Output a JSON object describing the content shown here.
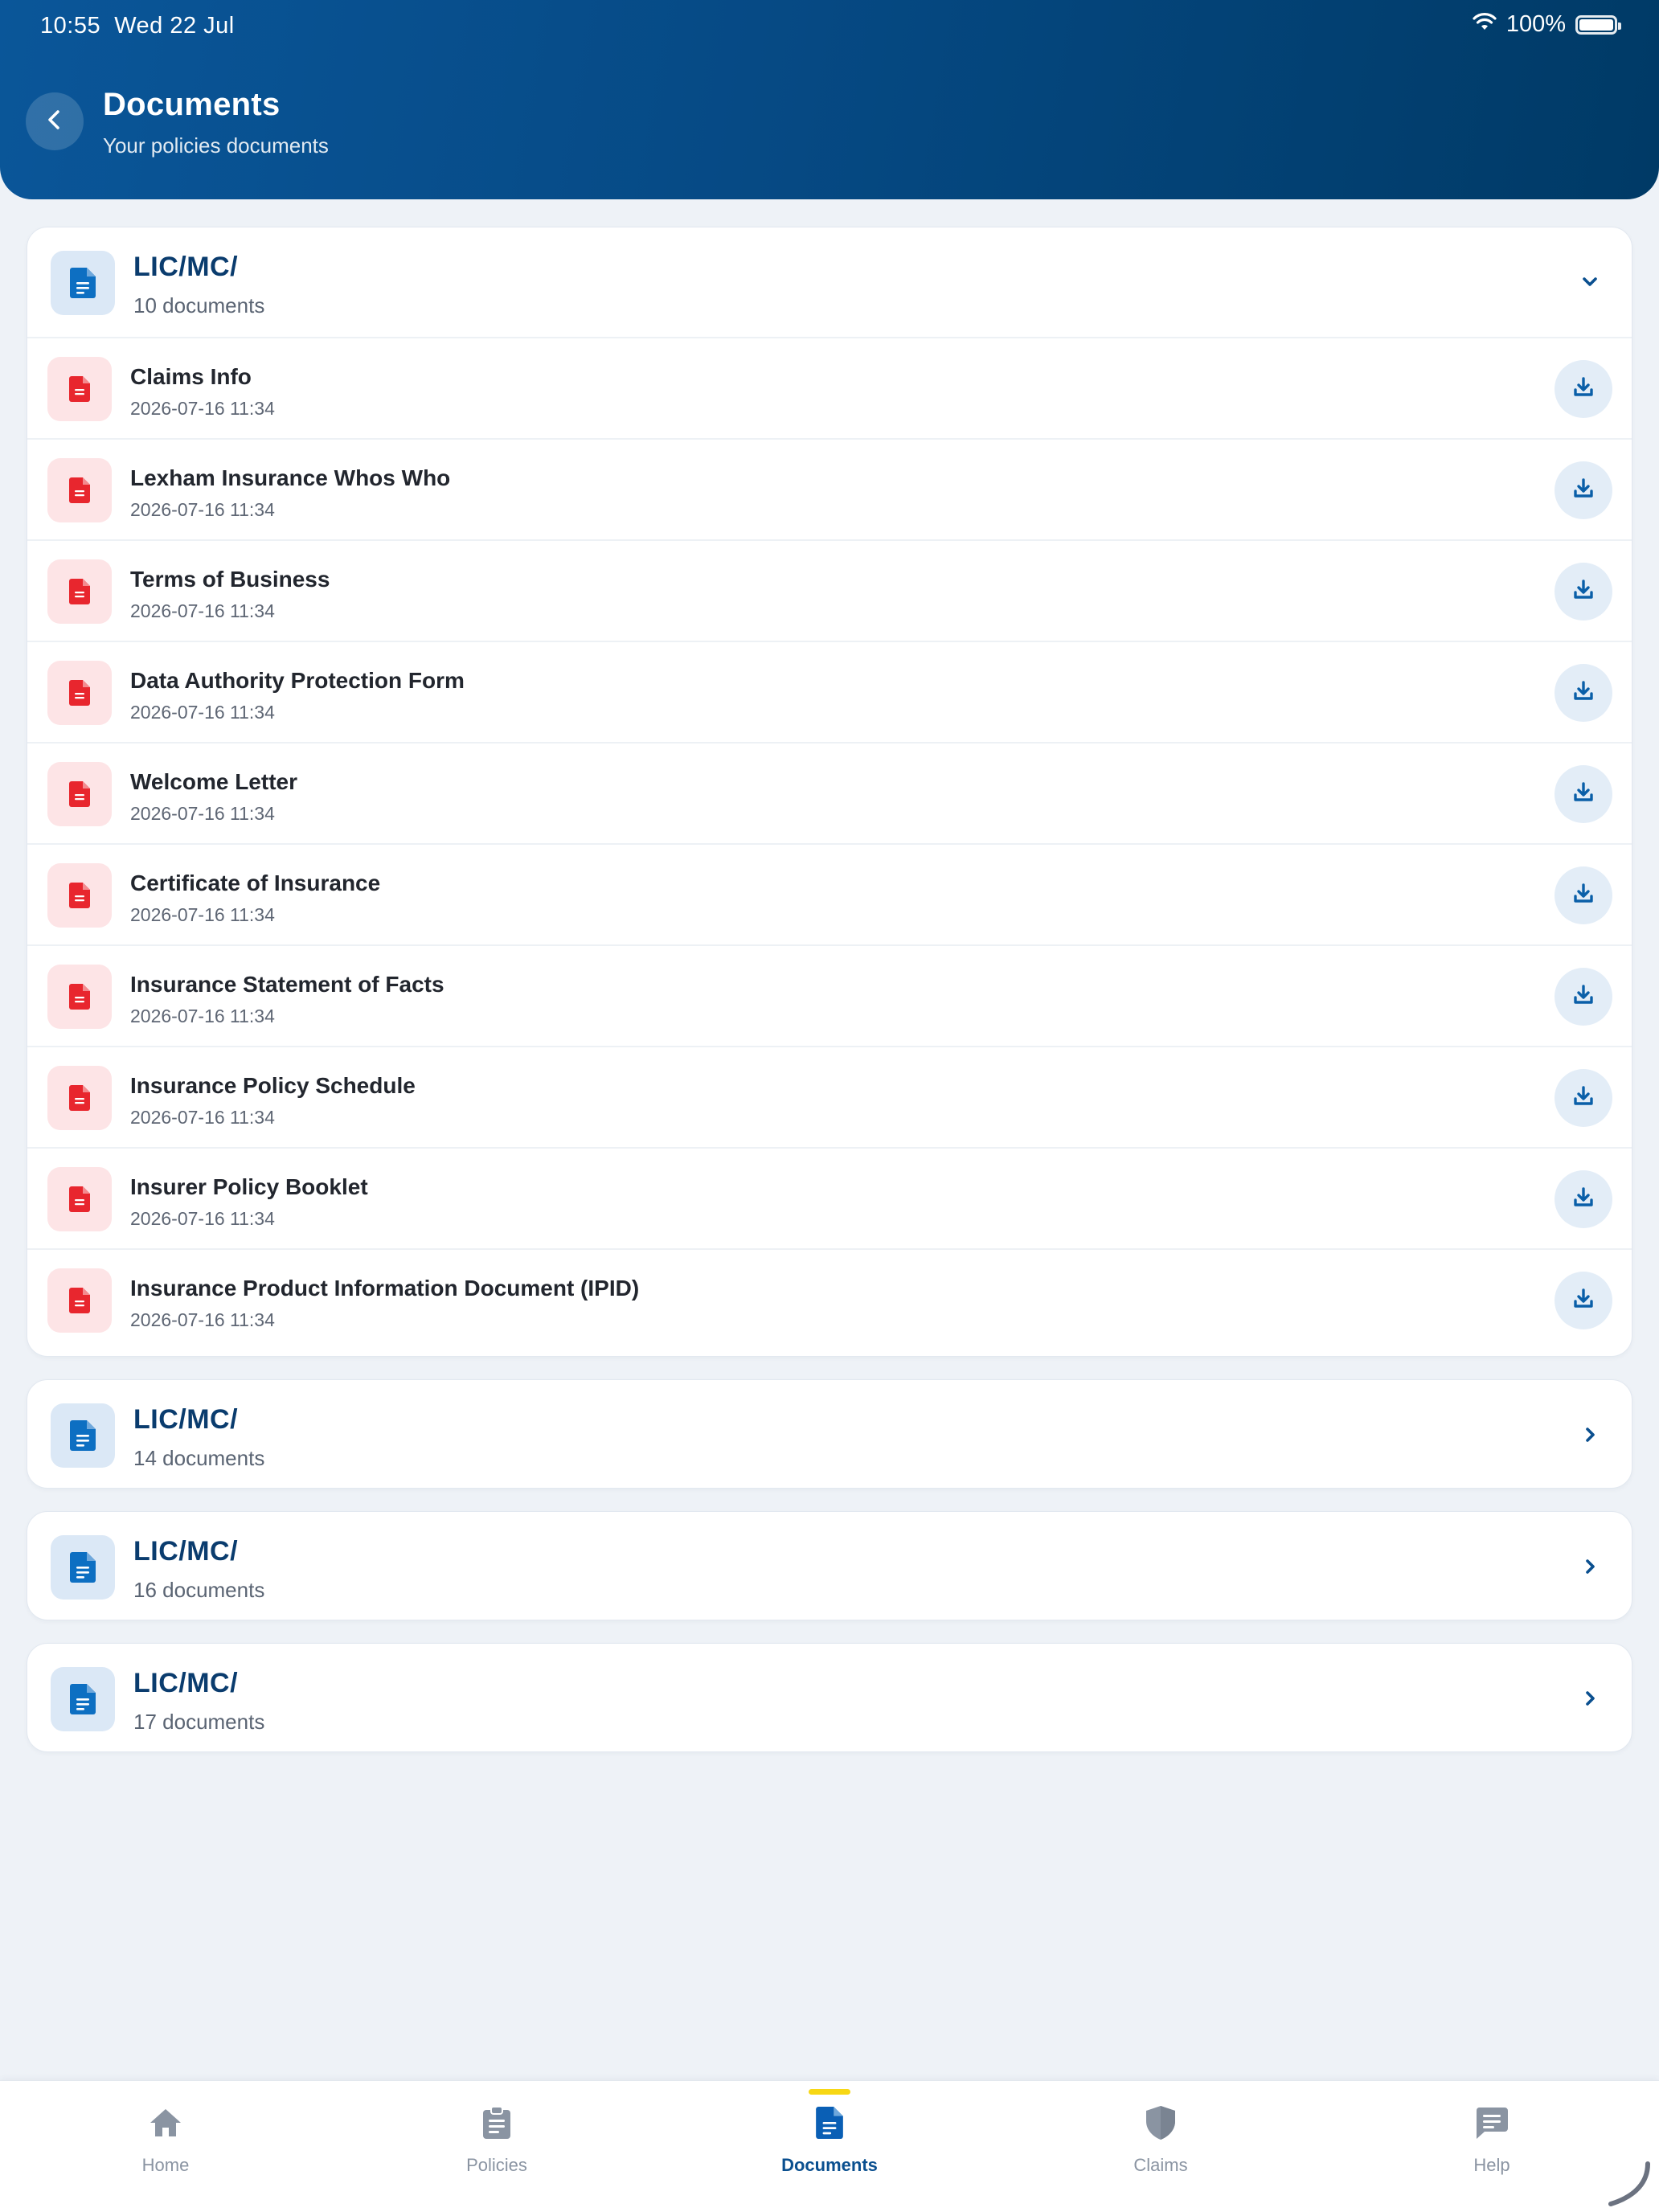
{
  "status_bar": {
    "time": "10:55",
    "date": "Wed 22 Jul",
    "battery": "100%"
  },
  "header": {
    "title": "Documents",
    "subtitle": "Your policies documents"
  },
  "groups": [
    {
      "title": "LIC/MC/",
      "count": "10 documents",
      "expanded": true,
      "documents": [
        {
          "name": "Claims Info",
          "date": "2026-07-16 11:34"
        },
        {
          "name": "Lexham Insurance Whos Who",
          "date": "2026-07-16 11:34"
        },
        {
          "name": "Terms of Business",
          "date": "2026-07-16 11:34"
        },
        {
          "name": "Data Authority Protection Form",
          "date": "2026-07-16 11:34"
        },
        {
          "name": "Welcome Letter",
          "date": "2026-07-16 11:34"
        },
        {
          "name": "Certificate of Insurance",
          "date": "2026-07-16 11:34"
        },
        {
          "name": "Insurance Statement of Facts",
          "date": "2026-07-16 11:34"
        },
        {
          "name": "Insurance Policy Schedule",
          "date": "2026-07-16 11:34"
        },
        {
          "name": "Insurer Policy Booklet",
          "date": "2026-07-16 11:34"
        },
        {
          "name": "Insurance Product Information Document (IPID)",
          "date": "2026-07-16 11:34"
        }
      ]
    },
    {
      "title": "LIC/MC/",
      "count": "14 documents",
      "expanded": false,
      "documents": []
    },
    {
      "title": "LIC/MC/",
      "count": "16 documents",
      "expanded": false,
      "documents": []
    },
    {
      "title": "LIC/MC/",
      "count": "17 documents",
      "expanded": false,
      "documents": []
    }
  ],
  "nav": [
    {
      "label": "Home",
      "icon": "home-icon",
      "active": false
    },
    {
      "label": "Policies",
      "icon": "clipboard-icon",
      "active": false
    },
    {
      "label": "Documents",
      "icon": "document-icon",
      "active": true
    },
    {
      "label": "Claims",
      "icon": "shield-icon",
      "active": false
    },
    {
      "label": "Help",
      "icon": "chat-icon",
      "active": false
    }
  ],
  "colors": {
    "brand": "#0a4f8f",
    "header_gradient_start": "#0a5699",
    "header_gradient_end": "#003a66",
    "pdf_red": "#e8262e",
    "active_indicator": "#f7d714",
    "background": "#eef2f7"
  }
}
